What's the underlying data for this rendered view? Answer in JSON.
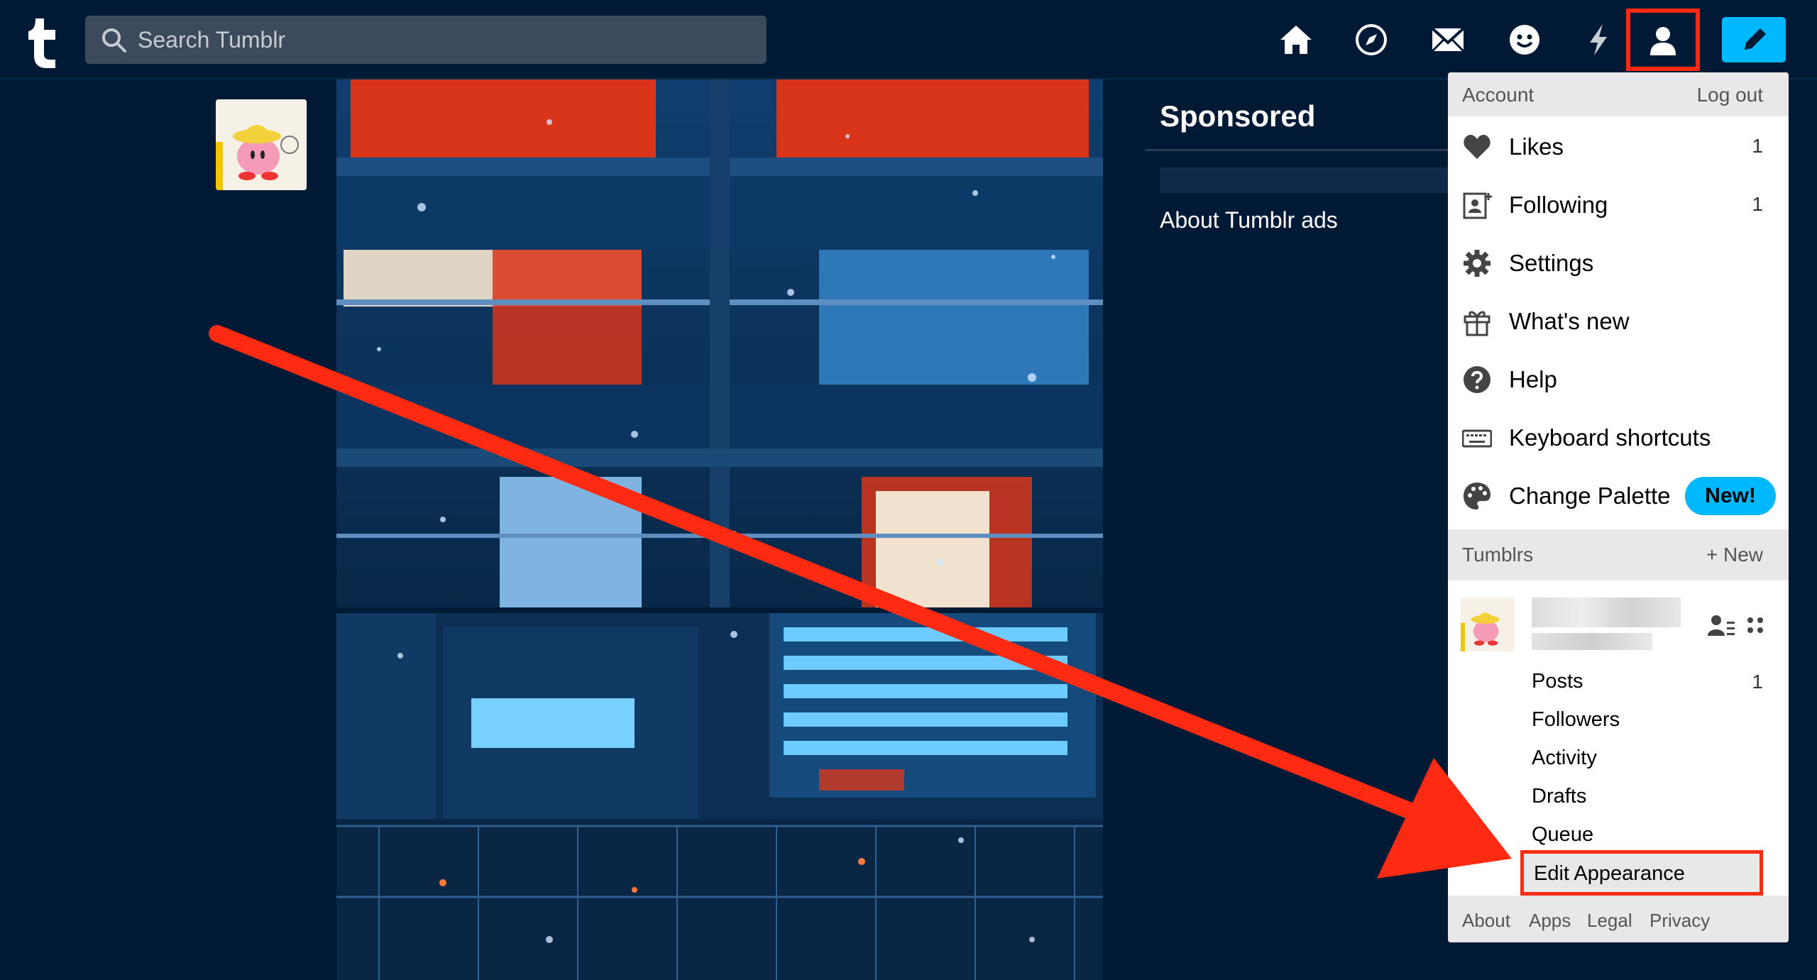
{
  "search": {
    "placeholder": "Search Tumblr"
  },
  "nav": {
    "icons": [
      "home-icon",
      "explore-icon",
      "inbox-icon",
      "messages-icon",
      "activity-icon",
      "account-icon",
      "compose-icon"
    ]
  },
  "sponsored": {
    "title": "Sponsored",
    "about_link": "About Tumblr ads"
  },
  "account_menu": {
    "header_label": "Account",
    "logout_label": "Log out",
    "items": [
      {
        "label": "Likes",
        "count": "1",
        "icon": "heart-icon"
      },
      {
        "label": "Following",
        "count": "1",
        "icon": "following-icon"
      },
      {
        "label": "Settings",
        "count": "",
        "icon": "gear-icon"
      },
      {
        "label": "What's new",
        "count": "",
        "icon": "gift-icon"
      },
      {
        "label": "Help",
        "count": "",
        "icon": "help-icon"
      },
      {
        "label": "Keyboard shortcuts",
        "count": "",
        "icon": "keyboard-icon"
      },
      {
        "label": "Change Palette",
        "count": "",
        "icon": "palette-icon",
        "badge": "New!"
      }
    ],
    "tumblrs_label": "Tumblrs",
    "new_tumblr_label": "+ New",
    "blog_sub_items": [
      {
        "label": "Posts",
        "count": "1"
      },
      {
        "label": "Followers",
        "count": ""
      },
      {
        "label": "Activity",
        "count": ""
      },
      {
        "label": "Drafts",
        "count": ""
      },
      {
        "label": "Queue",
        "count": ""
      },
      {
        "label": "Edit Appearance",
        "count": ""
      }
    ],
    "footer_links": [
      "About",
      "Apps",
      "Legal",
      "Privacy"
    ]
  },
  "colors": {
    "background": "#001935",
    "accent": "#00b8ff",
    "highlight": "#ff2a12",
    "menu_bg": "#ffffff"
  }
}
